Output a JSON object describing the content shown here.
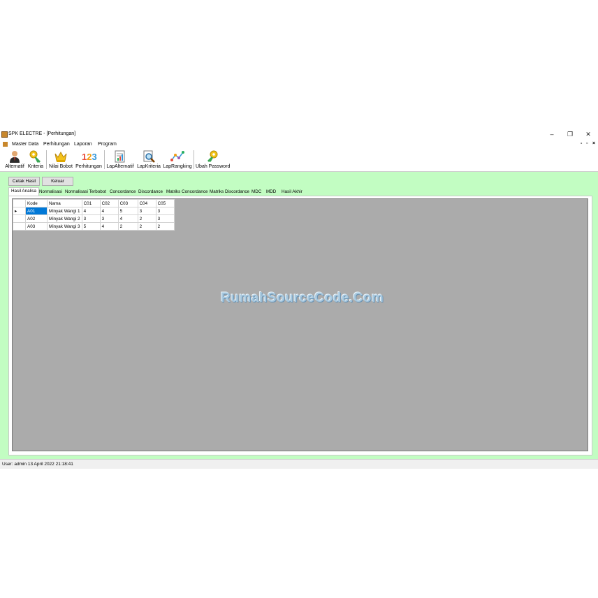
{
  "window": {
    "title": "SPK ELECTRE - [Perhitungan]",
    "minimize": "–",
    "restore": "❐",
    "close": "✕"
  },
  "menu": {
    "items": [
      "Master Data",
      "Perhitungan",
      "Laporan",
      "Program"
    ],
    "mdi_controls": [
      "-",
      "▫",
      "×"
    ]
  },
  "toolbar": {
    "items": [
      {
        "label": "Alternatif",
        "icon": "user-icon"
      },
      {
        "label": "Kriteria",
        "icon": "key-icon"
      },
      {
        "label": "Nilai Bobot",
        "icon": "crown-icon"
      },
      {
        "label": "Perhitungan",
        "icon": "numbers-icon"
      },
      {
        "label": "LapAlternatif",
        "icon": "report-icon"
      },
      {
        "label": "LapKriteria",
        "icon": "magnifier-report-icon"
      },
      {
        "label": "LapRangking",
        "icon": "chart-icon"
      },
      {
        "label": "Ubah Password",
        "icon": "key-icon"
      }
    ]
  },
  "actions": {
    "print_label": "Cetak Hasil",
    "exit_label": "Keluar"
  },
  "tabs": [
    "Hasil Analisa",
    "Normalisasi",
    "Normalisasi Terbobot",
    "Concordance",
    "Discordance",
    "Matriks Concordance",
    "Matriks Discordance",
    "MDC",
    "MDD",
    "Hasil Akhir"
  ],
  "grid": {
    "current_row_marker": "▸",
    "columns": [
      "Kode",
      "Nama",
      "C01",
      "C02",
      "C03",
      "C04",
      "C05"
    ],
    "rows": [
      [
        "A01",
        "Minyak Wangi 1",
        "4",
        "4",
        "5",
        "3",
        "3"
      ],
      [
        "A02",
        "Minyak Wangi 2",
        "3",
        "3",
        "4",
        "2",
        "3"
      ],
      [
        "A03",
        "Minyak Wangi 3",
        "5",
        "4",
        "2",
        "2",
        "2"
      ]
    ]
  },
  "watermark": "RumahSourceCode.Com",
  "status": {
    "text": "User: admin  13 April 2022 21:18:41"
  },
  "colors": {
    "background": "#c2fdc2",
    "grid_background": "#ababab",
    "selection": "#0078d7"
  }
}
